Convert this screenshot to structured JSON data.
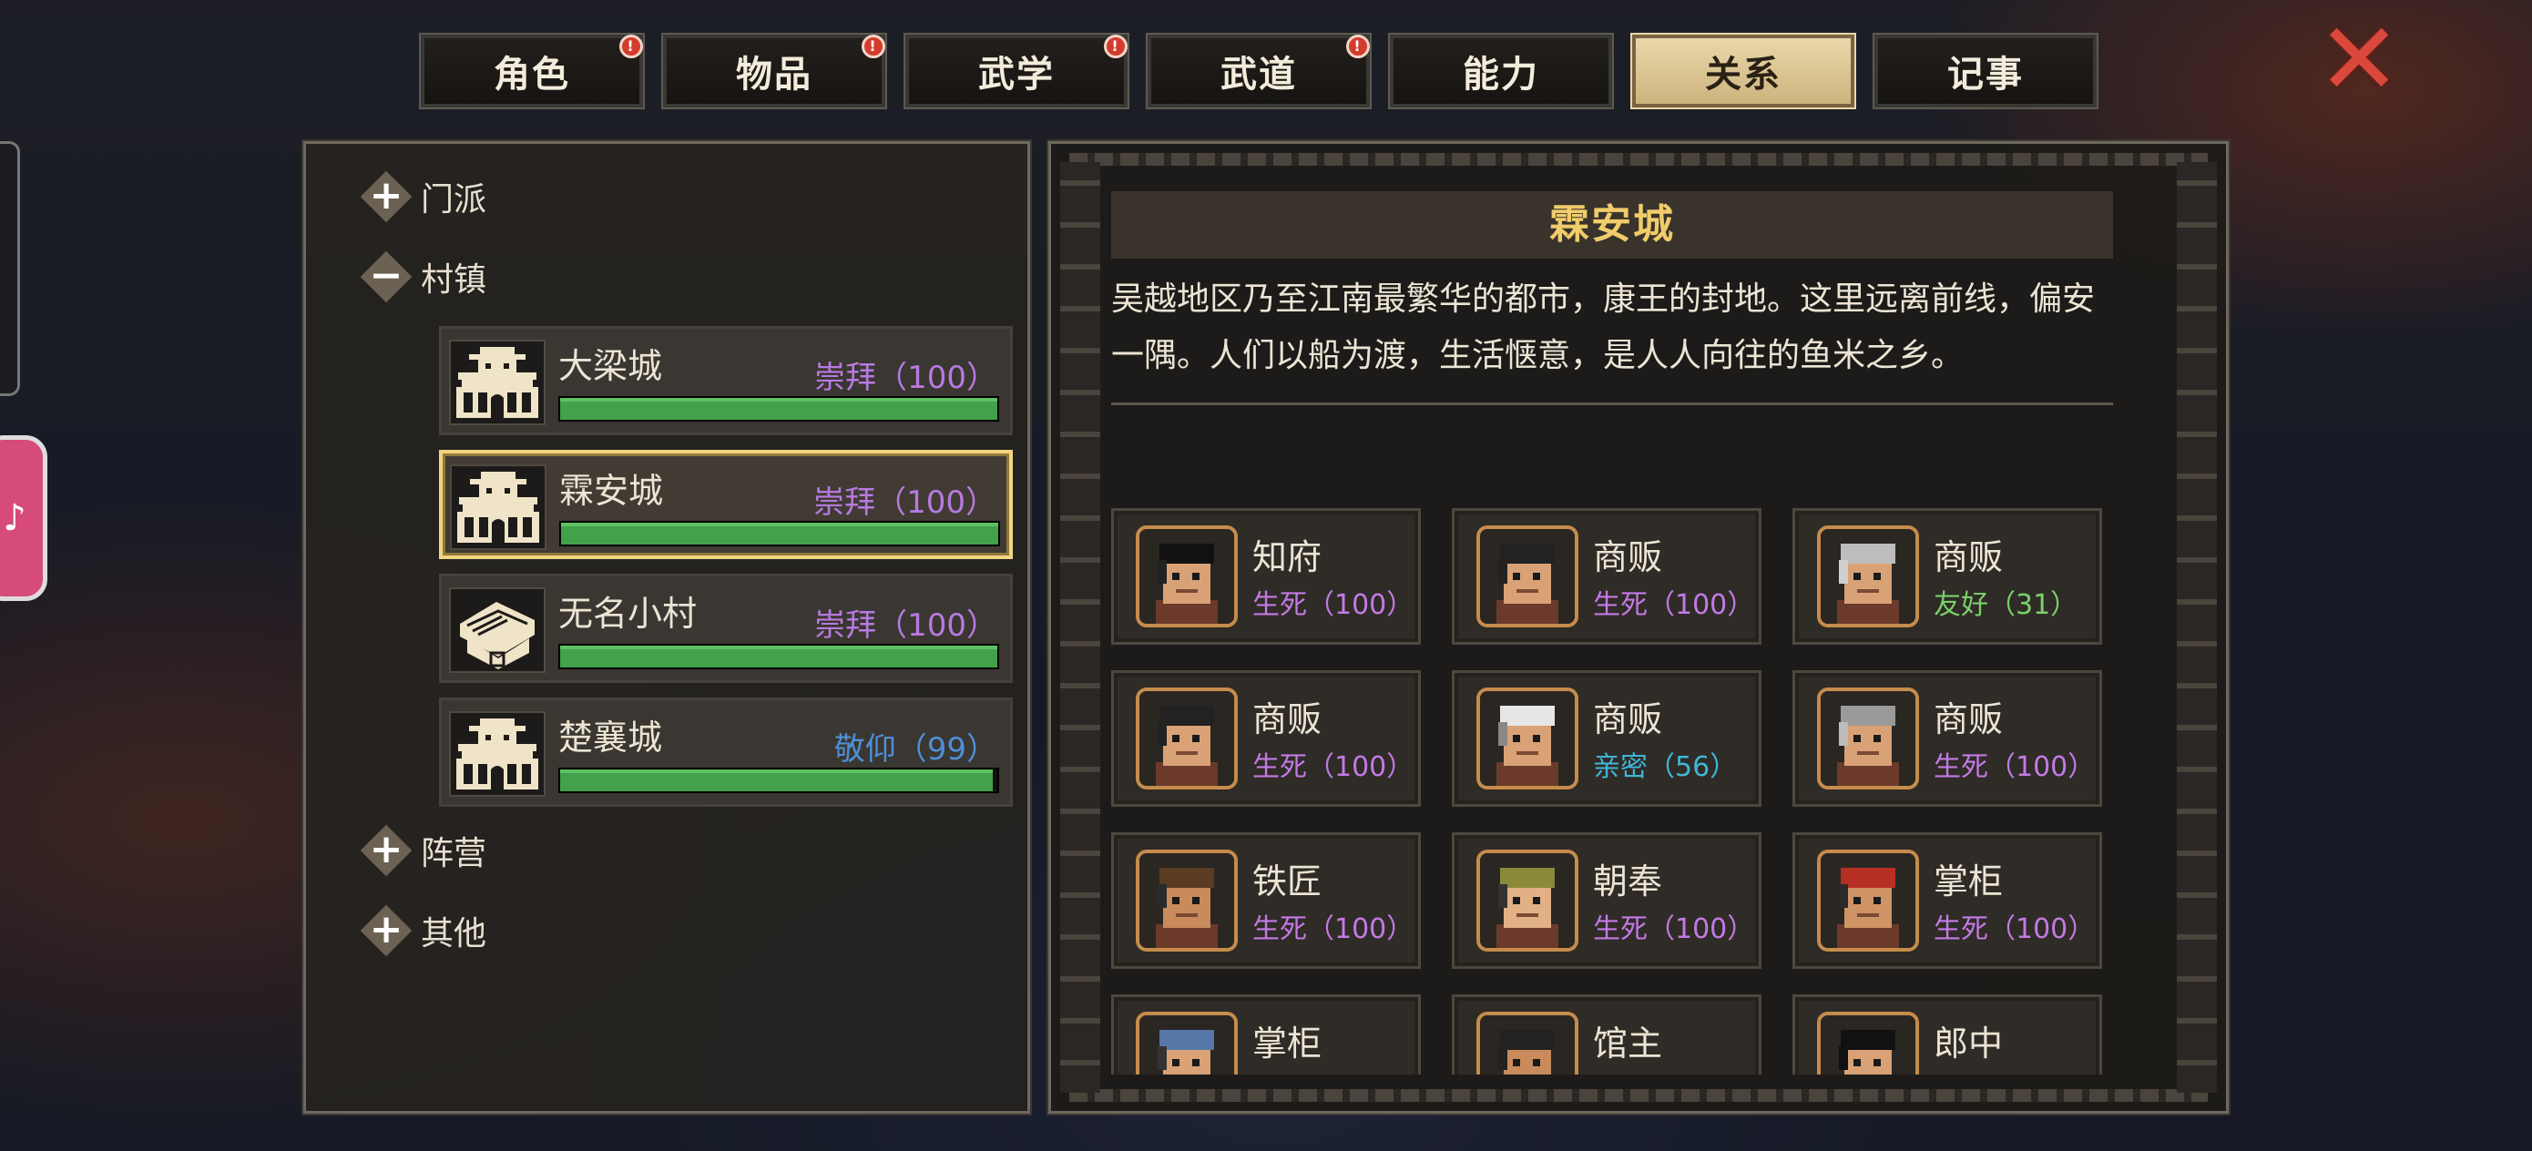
{
  "tabs": [
    {
      "label": "角色",
      "alert": true
    },
    {
      "label": "物品",
      "alert": true
    },
    {
      "label": "武学",
      "alert": true
    },
    {
      "label": "武道",
      "alert": true
    },
    {
      "label": "能力",
      "alert": false
    },
    {
      "label": "关系",
      "alert": false,
      "active": true
    },
    {
      "label": "记事",
      "alert": false
    }
  ],
  "close_icon": "close-x-icon",
  "left": {
    "groups": [
      {
        "label": "门派",
        "state": "+"
      },
      {
        "label": "村镇",
        "state": "−"
      },
      {
        "label": "阵营",
        "state": "+"
      },
      {
        "label": "其他",
        "state": "+"
      }
    ],
    "towns": [
      {
        "name": "大梁城",
        "status": "崇拜（100）",
        "level": 1.0,
        "icon": "city-gate-icon",
        "selected": false
      },
      {
        "name": "霖安城",
        "status": "崇拜（100）",
        "level": 1.0,
        "icon": "city-gate-icon",
        "selected": true
      },
      {
        "name": "无名小村",
        "status": "崇拜（100）",
        "level": 1.0,
        "icon": "village-house-icon",
        "selected": false
      },
      {
        "name": "楚襄城",
        "status": "敬仰（99）",
        "level": 0.99,
        "icon": "city-gate-icon",
        "selected": false
      }
    ]
  },
  "detail": {
    "title": "霖安城",
    "description": "吴越地区乃至江南最繁华的都市，康王的封地。这里远离前线，偏安一隅。人们以船为渡，生活惬意，是人人向往的鱼米之乡。",
    "people": [
      {
        "role": "知府",
        "status": "生死（100）",
        "type": "life",
        "hair": "#222",
        "skin": "#d9a276",
        "hat": "#111"
      },
      {
        "role": "商贩",
        "status": "生死（100）",
        "type": "life",
        "hair": "#222",
        "skin": "#d9a276",
        "hat": "#222"
      },
      {
        "role": "商贩",
        "status": "友好（31）",
        "type": "friend",
        "hair": "#cfcfcf",
        "skin": "#d9a276",
        "hat": "#bdbdbd"
      },
      {
        "role": "商贩",
        "status": "生死（100）",
        "type": "life",
        "hair": "#222",
        "skin": "#d9a276",
        "hat": "#222"
      },
      {
        "role": "商贩",
        "status": "亲密（56）",
        "type": "close-rel",
        "hair": "#888",
        "skin": "#d9a276",
        "hat": "#e6e6e6"
      },
      {
        "role": "商贩",
        "status": "生死（100）",
        "type": "life",
        "hair": "#bcbcbc",
        "skin": "#d9a276",
        "hat": "#9a9a9a"
      },
      {
        "role": "铁匠",
        "status": "生死（100）",
        "type": "life",
        "hair": "#2a2a2a",
        "skin": "#c98a5c",
        "hat": "#5a3c22"
      },
      {
        "role": "朝奉",
        "status": "生死（100）",
        "type": "life",
        "hair": "#333",
        "skin": "#e2b085",
        "hat": "#8a8a3a"
      },
      {
        "role": "掌柜",
        "status": "生死（100）",
        "type": "life",
        "hair": "#2a2a2a",
        "skin": "#cf9466",
        "hat": "#b52f22"
      },
      {
        "role": "掌柜",
        "status": "",
        "type": "life",
        "hair": "#333",
        "skin": "#d9a276",
        "hat": "#5777a8"
      },
      {
        "role": "馆主",
        "status": "",
        "type": "life",
        "hair": "#222",
        "skin": "#c98a5c",
        "hat": "#222"
      },
      {
        "role": "郎中",
        "status": "",
        "type": "life",
        "hair": "#111",
        "skin": "#d9a276",
        "hat": "#111"
      }
    ]
  }
}
